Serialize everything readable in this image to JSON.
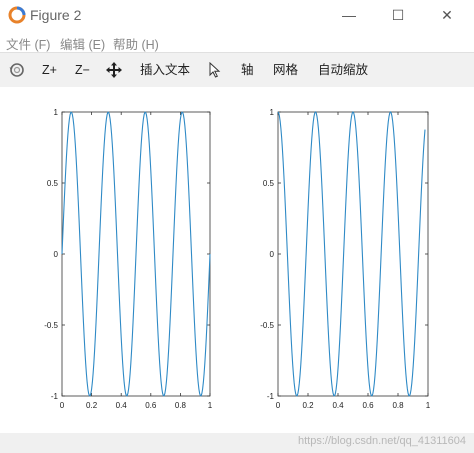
{
  "window": {
    "title": "Figure 2",
    "minimize_glyph": "—",
    "maximize_glyph": "☐",
    "close_glyph": "✕",
    "icon": "octave-icon"
  },
  "menu": {
    "items": [
      {
        "label": "文件 (F)"
      },
      {
        "label": "编辑 (E)"
      },
      {
        "label": "帮助 (H)"
      }
    ]
  },
  "toolbar": {
    "rotate_icon": "rotate-icon",
    "zoom_in": "Z+",
    "zoom_out": "Z−",
    "pan_icon": "pan-icon",
    "insert_text": "插入文本",
    "select_icon": "pointer-icon",
    "axis": "轴",
    "grid": "网格",
    "autoscale": "自动缩放"
  },
  "status": {
    "watermark": "https://blog.csdn.net/qq_41311604"
  },
  "colors": {
    "line": "#2f8ac6",
    "toolbar_bg": "#f1f1f1"
  },
  "chart_data": [
    {
      "type": "line",
      "title": "",
      "xlabel": "",
      "ylabel": "",
      "xlim": [
        0,
        1
      ],
      "ylim": [
        -1,
        1
      ],
      "xticks": [
        "0",
        "0.2",
        "0.4",
        "0.6",
        "0.8",
        "1"
      ],
      "yticks": [
        "-1",
        "-0.5",
        "0",
        "0.5",
        "1"
      ],
      "series": [
        {
          "function": "sin(2*pi*4*x)",
          "frequency": 4,
          "x_start": 0,
          "x_end": 1,
          "samples": 200
        }
      ]
    },
    {
      "type": "line",
      "title": "",
      "xlabel": "",
      "ylabel": "",
      "xlim": [
        0,
        1
      ],
      "ylim": [
        -1,
        1
      ],
      "xticks": [
        "0",
        "0.2",
        "0.4",
        "0.6",
        "0.8",
        "1"
      ],
      "yticks": [
        "-1",
        "-0.5",
        "0",
        "0.5",
        "1"
      ],
      "series": [
        {
          "function": "cos(2*pi*4*x)",
          "frequency": 4,
          "x_start": 0,
          "x_end": 0.98,
          "samples": 200
        }
      ]
    }
  ]
}
